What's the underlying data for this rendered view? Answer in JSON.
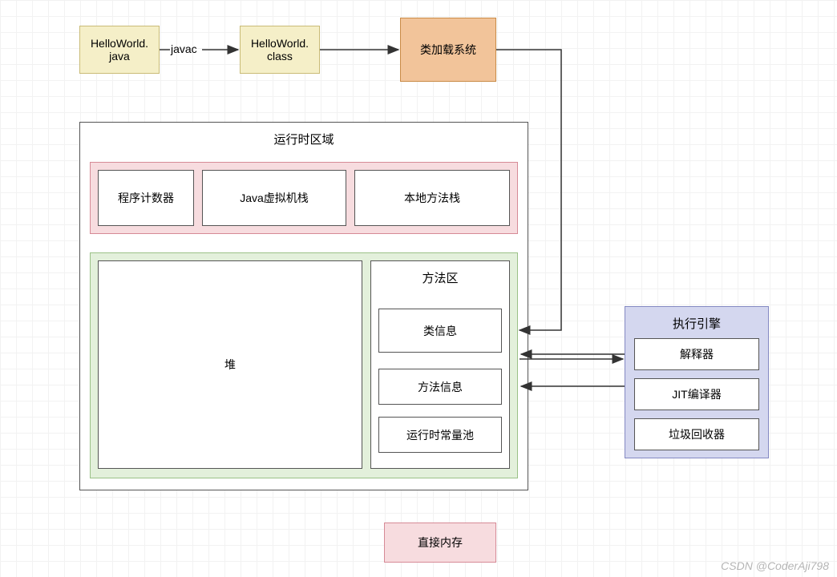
{
  "top": {
    "src_file": "HelloWorld.\njava",
    "compiler_label": "javac",
    "class_file": "HelloWorld.\nclass",
    "class_loader": "类加载系统"
  },
  "runtime": {
    "title": "运行时区域",
    "thread_private": {
      "pc": "程序计数器",
      "jvm_stack": "Java虚拟机栈",
      "native_stack": "本地方法栈"
    },
    "shared": {
      "heap": "堆",
      "method_area": {
        "title": "方法区",
        "class_info": "类信息",
        "method_info": "方法信息",
        "runtime_const_pool": "运行时常量池"
      }
    }
  },
  "engine": {
    "title": "执行引擎",
    "interpreter": "解释器",
    "jit": "JIT编译器",
    "gc": "垃圾回收器"
  },
  "direct_memory": "直接内存",
  "watermark": "CSDN @CoderAji798"
}
